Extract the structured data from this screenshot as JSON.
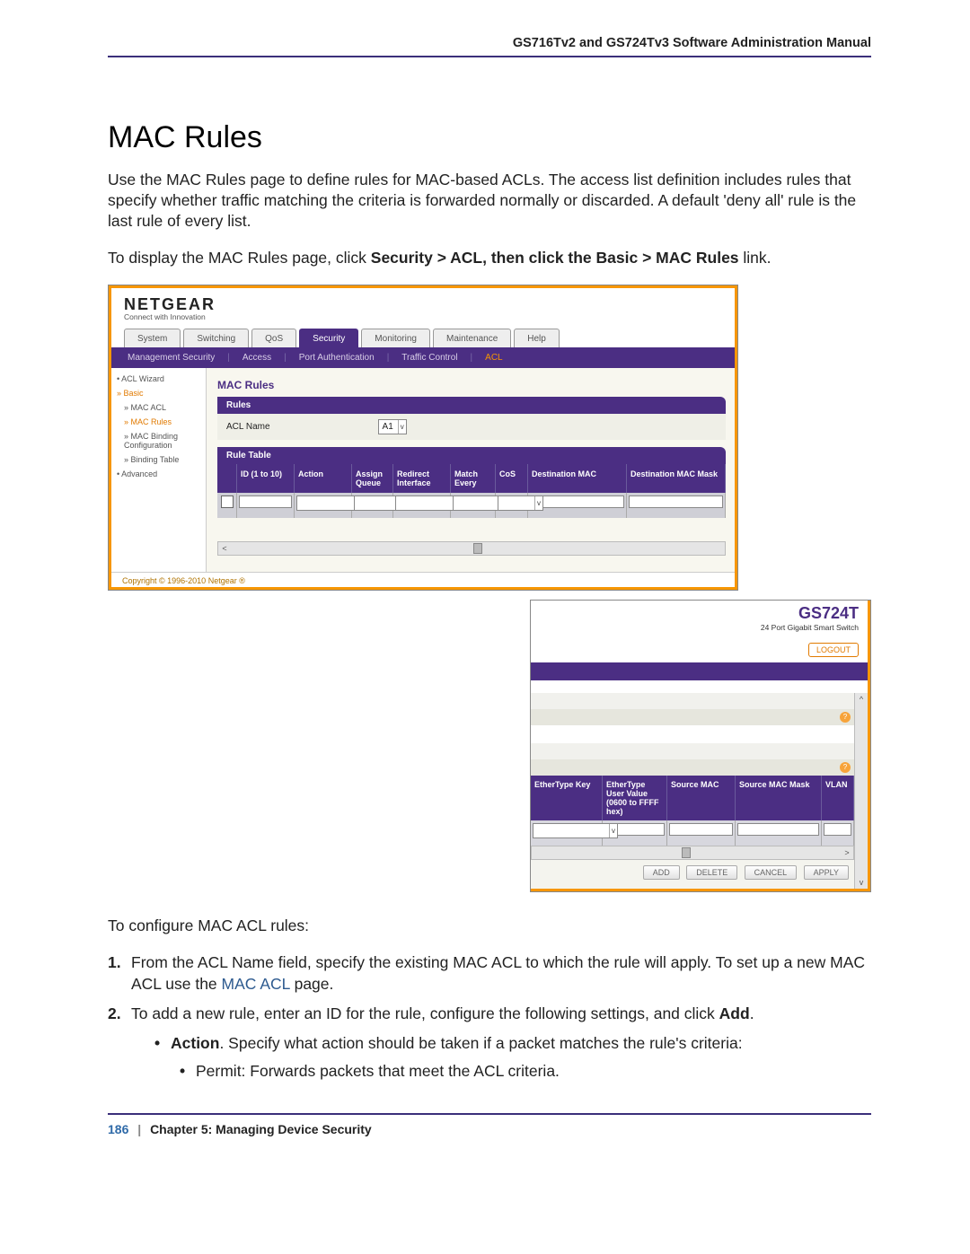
{
  "doc": {
    "header": "GS716Tv2 and GS724Tv3 Software Administration Manual",
    "title": "MAC Rules",
    "para1": "Use the MAC Rules page to define rules for MAC-based ACLs. The access list definition includes rules that specify whether traffic matching the criteria is forwarded normally or discarded. A default 'deny all' rule is the last rule of every list.",
    "para2_pre": "To display the MAC Rules page, click ",
    "para2_bold": "Security > ACL, then click the Basic > MAC Rules",
    "para2_post": " link.",
    "config_intro": "To configure MAC ACL rules:",
    "step1_a": "From the ACL Name field, specify the existing MAC ACL to which the rule will apply. To set up a new MAC ACL use the ",
    "step1_link": "MAC ACL",
    "step1_b": " page.",
    "step2_a": "To add a new rule, enter an ID for the rule, configure the following settings, and click ",
    "step2_bold": "Add",
    "step2_b": ".",
    "bul_action_label": "Action",
    "bul_action_text": ". Specify what action should be taken if a packet matches the rule's criteria:",
    "bul_permit": "Permit: Forwards packets that meet the ACL criteria.",
    "footer_page": "186",
    "footer_chap": "Chapter 5:  Managing Device Security"
  },
  "scrA": {
    "brand": "NETGEAR",
    "brand_tag": "Connect with Innovation",
    "tabs": [
      "System",
      "Switching",
      "QoS",
      "Security",
      "Monitoring",
      "Maintenance",
      "Help"
    ],
    "tabs_active": "Security",
    "subnav": [
      "Management Security",
      "Access",
      "Port Authentication",
      "Traffic Control",
      "ACL"
    ],
    "subnav_active": "ACL",
    "side": {
      "wizard": "ACL Wizard",
      "basic": "Basic",
      "macacl": "MAC ACL",
      "macrules": "MAC Rules",
      "macbind": "MAC Binding Configuration",
      "bindtable": "Binding Table",
      "advanced": "Advanced"
    },
    "panel_title": "MAC Rules",
    "bar_rules": "Rules",
    "acl_name_label": "ACL Name",
    "acl_name_sel": "A1",
    "bar_ruletable": "Rule Table",
    "cols": {
      "id": "ID (1 to 10)",
      "action": "Action",
      "assign": "Assign Queue",
      "redirect": "Redirect Interface",
      "match": "Match Every",
      "cos": "CoS",
      "dmac": "Destination MAC",
      "dmask": "Destination MAC Mask"
    },
    "copyright": "Copyright © 1996-2010 Netgear ®"
  },
  "scrB": {
    "product": "GS724T",
    "product_tag": "24 Port Gigabit Smart Switch",
    "logout": "LOGOUT",
    "cols": {
      "etk": "EtherType Key",
      "euv": "EtherType User Value (0600 to FFFF hex)",
      "smac": "Source MAC",
      "smask": "Source MAC Mask",
      "vlan": "VLAN"
    },
    "btns": {
      "add": "ADD",
      "del": "DELETE",
      "cancel": "CANCEL",
      "apply": "APPLY"
    }
  }
}
